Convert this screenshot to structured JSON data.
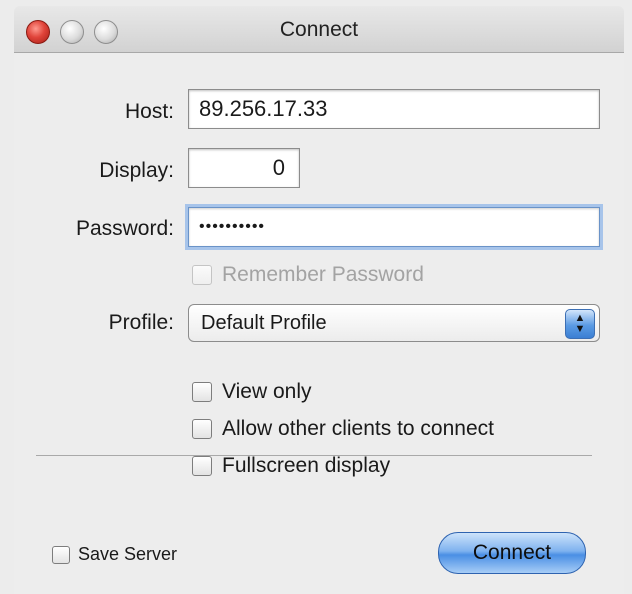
{
  "window": {
    "title": "Connect"
  },
  "form": {
    "host_label": "Host:",
    "host_value": "89.256.17.33",
    "display_label": "Display:",
    "display_value": "0",
    "password_label": "Password:",
    "password_value": "••••••••••",
    "remember_password_label": "Remember Password",
    "profile_label": "Profile:",
    "profile_value": "Default Profile"
  },
  "options": {
    "view_only": "View only",
    "allow_other_clients": "Allow other clients to connect",
    "fullscreen_display": "Fullscreen display"
  },
  "footer": {
    "save_server_label": "Save Server",
    "connect_button": "Connect"
  },
  "colors": {
    "close_button": "#e0443a",
    "accent_blue": "#5b9be4",
    "focus_ring": "#a7c4ea"
  }
}
